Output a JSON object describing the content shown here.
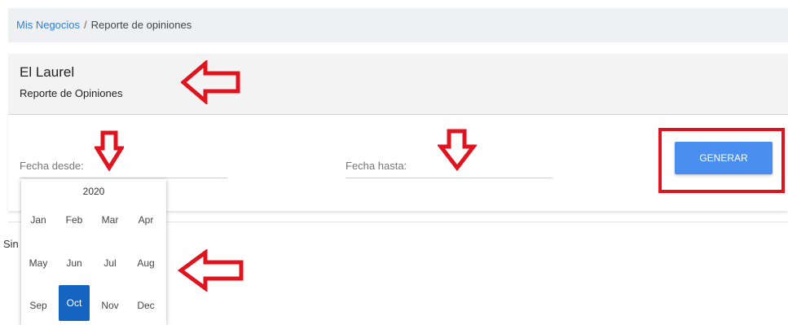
{
  "breadcrumb": {
    "parent": "Mis Negocios",
    "separator": "/",
    "current": "Reporte de opiniones"
  },
  "header": {
    "business_name": "El Laurel",
    "subtitle": "Reporte de Opiniones"
  },
  "form": {
    "date_from_label": "Fecha desde:",
    "date_to_label": "Fecha hasta:",
    "generate_button": "GENERAR"
  },
  "results_text": "Sin",
  "month_picker": {
    "year": "2020",
    "months": [
      "Jan",
      "Feb",
      "Mar",
      "Apr",
      "May",
      "Jun",
      "Jul",
      "Aug",
      "Sep",
      "Oct",
      "Nov",
      "Dec"
    ],
    "selected": "Oct"
  },
  "annotation_color": "#e0141e",
  "accent_color": "#4a8ff0"
}
